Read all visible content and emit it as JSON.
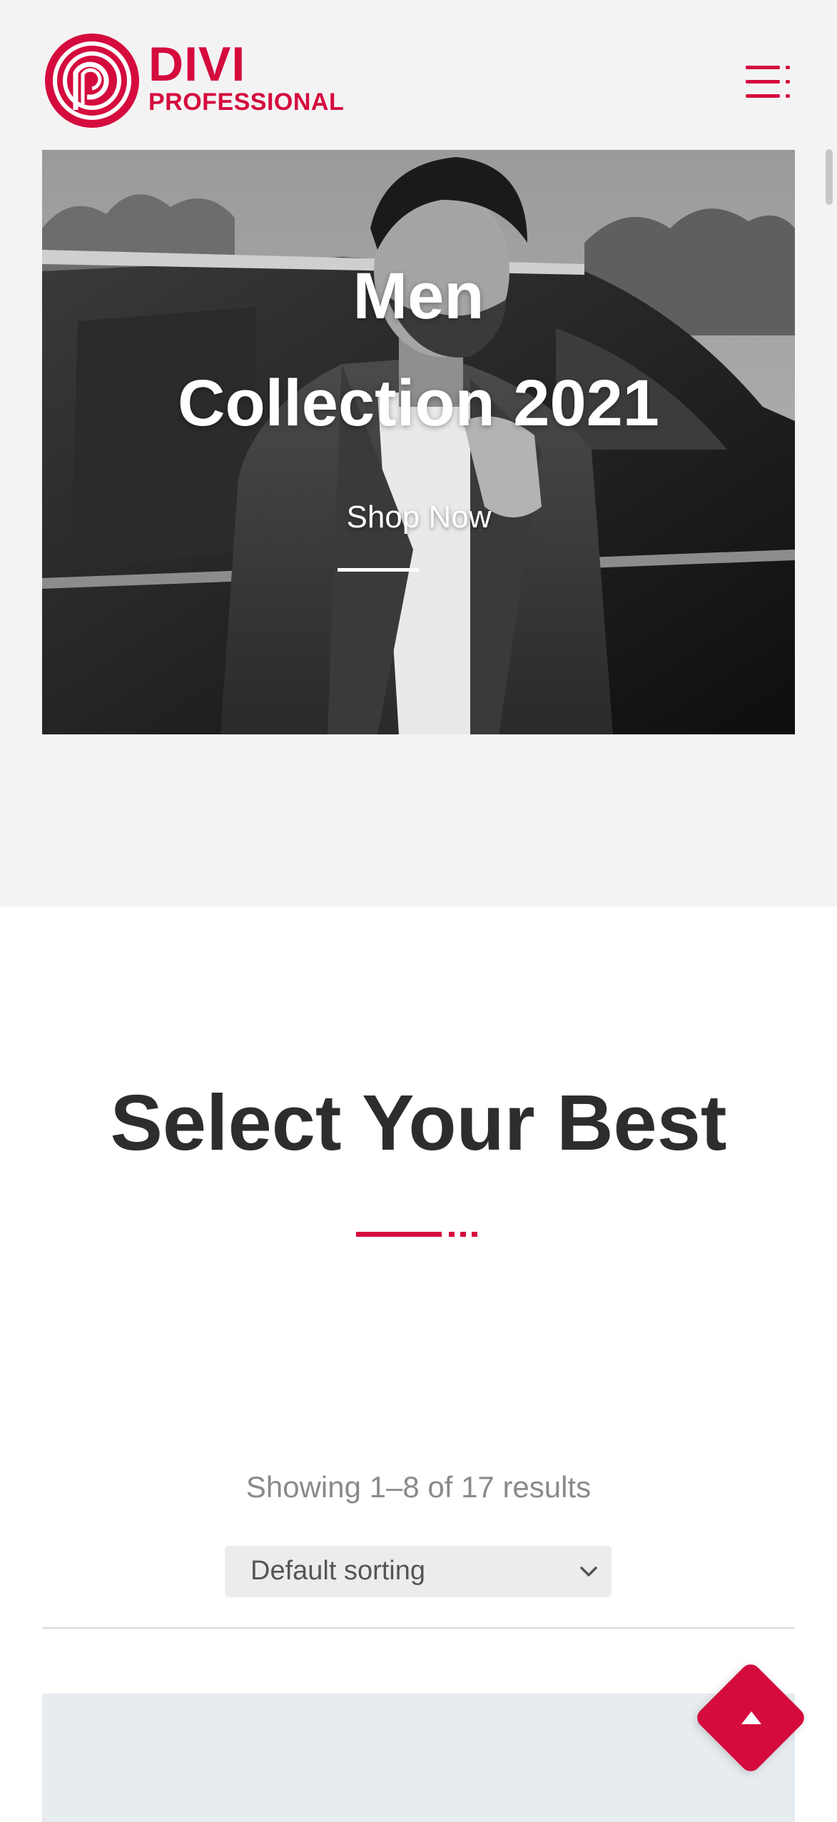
{
  "brand": {
    "name_line1": "DIVI",
    "name_line2": "PROFESSIONAL",
    "color": "#d50b3e"
  },
  "header": {
    "menu_icon": "hamburger-menu-icon"
  },
  "hero": {
    "title_line1": "Men",
    "title_line2": "Collection 2021",
    "cta_label": "Shop Now"
  },
  "section": {
    "title": "Select Your Best"
  },
  "shop": {
    "results_text": "Showing 1–8 of 17 results",
    "sort_selected": "Default sorting"
  },
  "back_to_top_icon": "arrow-up-icon"
}
